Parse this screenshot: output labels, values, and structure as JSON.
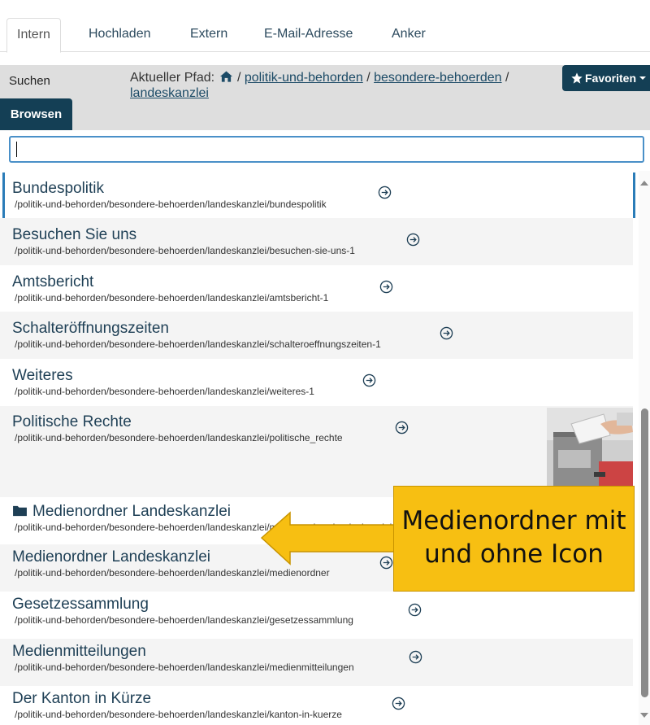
{
  "tabs": [
    {
      "label": "Intern",
      "active": true
    },
    {
      "label": "Hochladen"
    },
    {
      "label": "Extern"
    },
    {
      "label": "E-Mail-Adresse"
    },
    {
      "label": "Anker"
    }
  ],
  "nav": {
    "search_label": "Suchen",
    "browse_label": "Browsen"
  },
  "path": {
    "label": "Aktueller Pfad:",
    "segments": [
      "politik-und-behorden",
      "besondere-behoerden",
      "landeskanzlei"
    ]
  },
  "favorites_label": "Favoriten",
  "filter": {
    "value": "",
    "placeholder": ""
  },
  "items": [
    {
      "title": "Bundespolitik",
      "path": "/politik-und-behorden/besondere-behoerden/landeskanzlei/bundespolitik",
      "selected": true
    },
    {
      "title": "Besuchen Sie uns",
      "path": "/politik-und-behorden/besondere-behoerden/landeskanzlei/besuchen-sie-uns-1"
    },
    {
      "title": "Amtsbericht",
      "path": "/politik-und-behorden/besondere-behoerden/landeskanzlei/amtsbericht-1"
    },
    {
      "title": "Schalteröffnungszeiten",
      "path": "/politik-und-behorden/besondere-behoerden/landeskanzlei/schalteroeffnungszeiten-1"
    },
    {
      "title": "Weiteres",
      "path": "/politik-und-behorden/besondere-behoerden/landeskanzlei/weiteres-1"
    },
    {
      "title": "Politische Rechte",
      "path": "/politik-und-behorden/besondere-behoerden/landeskanzlei/politische_rechte",
      "has_image": true
    },
    {
      "title": "Medienordner Landeskanzlei",
      "path": "/politik-und-behorden/besondere-behoerden/landeskanzlei/medienordner-landeskanzlei",
      "icon": "folder-icon"
    },
    {
      "title": "Medienordner Landeskanzlei",
      "path": "/politik-und-behorden/besondere-behoerden/landeskanzlei/medienordner"
    },
    {
      "title": "Gesetzessammlung",
      "path": "/politik-und-behorden/besondere-behoerden/landeskanzlei/gesetzessammlung"
    },
    {
      "title": "Medienmitteilungen",
      "path": "/politik-und-behorden/besondere-behoerden/landeskanzlei/medienmitteilungen"
    },
    {
      "title": "Der Kanton in Kürze",
      "path": "/politik-und-behorden/besondere-behoerden/landeskanzlei/kanton-in-kuerze"
    }
  ],
  "annotation": {
    "line1": "Medienordner mit",
    "line2": "und ohne Icon"
  },
  "colors": {
    "primary": "#143f55",
    "link": "#1b4a66",
    "callout": "#f7bf12",
    "selected_marker": "#2a7cb8"
  }
}
